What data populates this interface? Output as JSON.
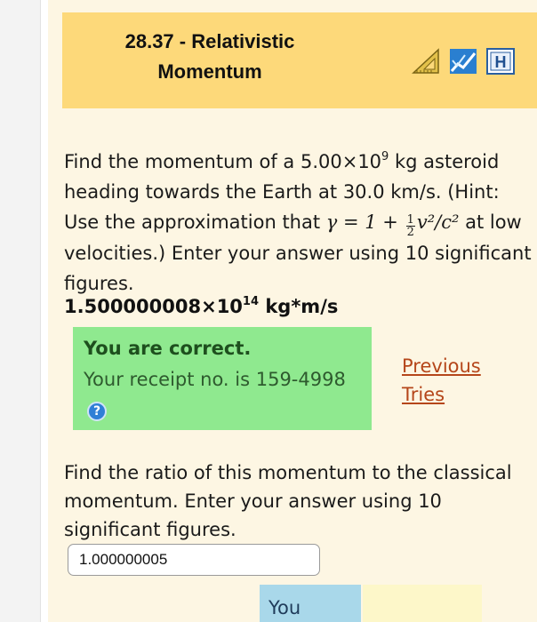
{
  "header": {
    "title_line1": "28.37 - Relativistic",
    "title_line2": "Momentum",
    "icons": [
      "ruler-triangle-icon",
      "checkmark-graph-icon",
      "hint-h-icon"
    ]
  },
  "question1": {
    "text_a": "Find the momentum of a 5.00×10",
    "exp_a": "9",
    "text_b": " kg asteroid heading towards the Earth at 30.0 km/s. (Hint: Use the approximation that ",
    "math_gamma": "γ = 1 + ",
    "frac_num": "1",
    "frac_den": "2",
    "math_tail": "v²/c²",
    "text_c": " at low velocities.) Enter your answer using 10 significant figures."
  },
  "answer1": {
    "mantissa": "1.500000008×10",
    "exponent": "14",
    "unit": " kg*m/s"
  },
  "feedback": {
    "title": "You are correct.",
    "receipt": "Your receipt no. is 159-4998",
    "help_icon": "question-mark-icon",
    "previous_tries": "Previous Tries"
  },
  "question2": {
    "text": "Find the ratio of this momentum to the classical momentum. Enter your answer using 10 significant figures.",
    "input_value": "1.000000005"
  },
  "footer": {
    "you_label": "You"
  },
  "colors": {
    "header_bg": "#fdd97a",
    "panel_bg": "#fdf6e3",
    "correct_bg": "#8fe98f",
    "link": "#b5461a",
    "you_bg": "#a9d8ea"
  }
}
